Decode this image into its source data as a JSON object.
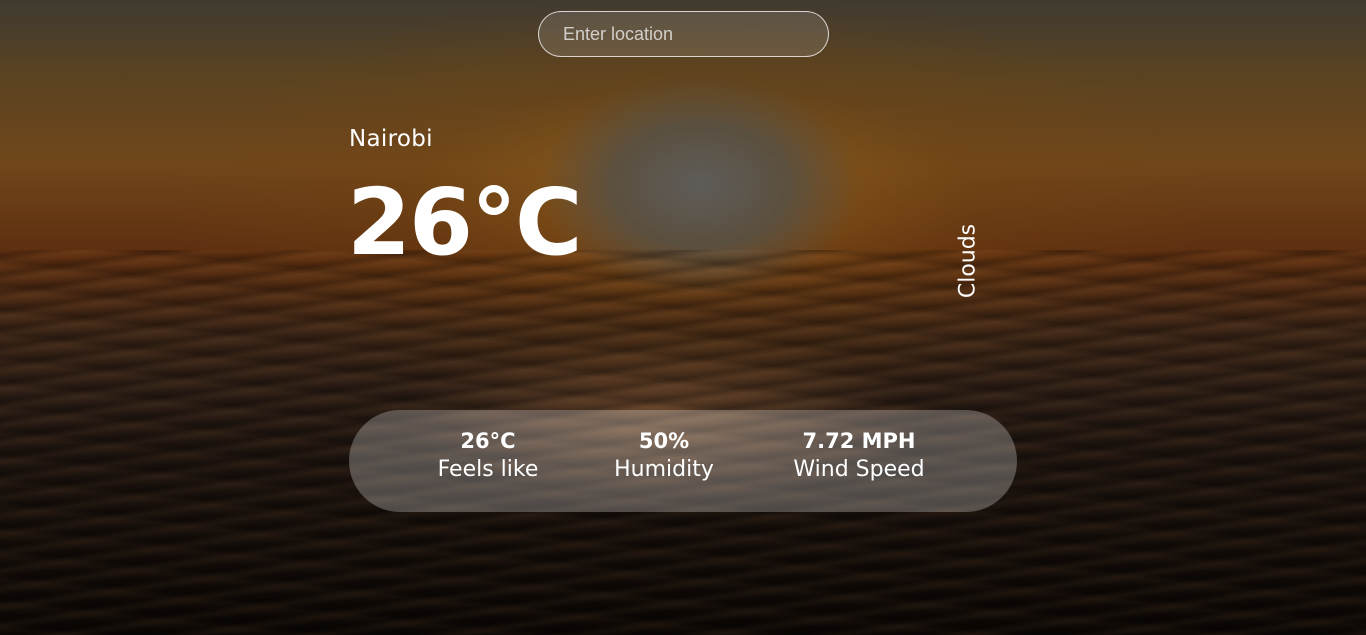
{
  "search": {
    "placeholder": "Enter location",
    "value": ""
  },
  "location": {
    "city": "Nairobi"
  },
  "current": {
    "temperature": "26°C",
    "condition": "Clouds"
  },
  "stats": [
    {
      "value": "26°C",
      "label": "Feels like"
    },
    {
      "value": "50%",
      "label": "Humidity"
    },
    {
      "value": "7.72 MPH",
      "label": "Wind Speed"
    }
  ]
}
